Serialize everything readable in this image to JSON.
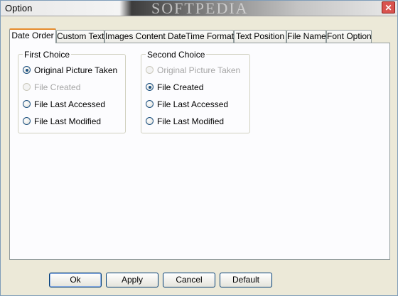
{
  "window": {
    "title": "Option",
    "watermark": "SOFTPEDIA",
    "close_glyph": "✕"
  },
  "tabs": [
    {
      "label": "Date Order",
      "active": true
    },
    {
      "label": "Custom Text",
      "active": false
    },
    {
      "label": "Images Content DateTime Format",
      "active": false
    },
    {
      "label": "Text Position",
      "active": false
    },
    {
      "label": "File Name",
      "active": false
    },
    {
      "label": "Font Option",
      "active": false
    }
  ],
  "first_choice": {
    "legend": "First Choice",
    "options": [
      {
        "label": "Original Picture Taken",
        "checked": true,
        "enabled": true
      },
      {
        "label": "File Created",
        "checked": false,
        "enabled": false
      },
      {
        "label": "File Last Accessed",
        "checked": false,
        "enabled": true
      },
      {
        "label": "File Last Modified",
        "checked": false,
        "enabled": true
      }
    ]
  },
  "second_choice": {
    "legend": "Second Choice",
    "options": [
      {
        "label": "Original Picture Taken",
        "checked": false,
        "enabled": false
      },
      {
        "label": "File Created",
        "checked": true,
        "enabled": true
      },
      {
        "label": "File Last Accessed",
        "checked": false,
        "enabled": true
      },
      {
        "label": "File Last Modified",
        "checked": false,
        "enabled": true
      }
    ]
  },
  "buttons": {
    "ok": "Ok",
    "apply": "Apply",
    "cancel": "Cancel",
    "default": "Default"
  },
  "colors": {
    "window_bg": "#ece9d8",
    "tab_accent": "#e68b2c",
    "radio_border": "#1c5180",
    "disabled_text": "#a6a6a6"
  }
}
